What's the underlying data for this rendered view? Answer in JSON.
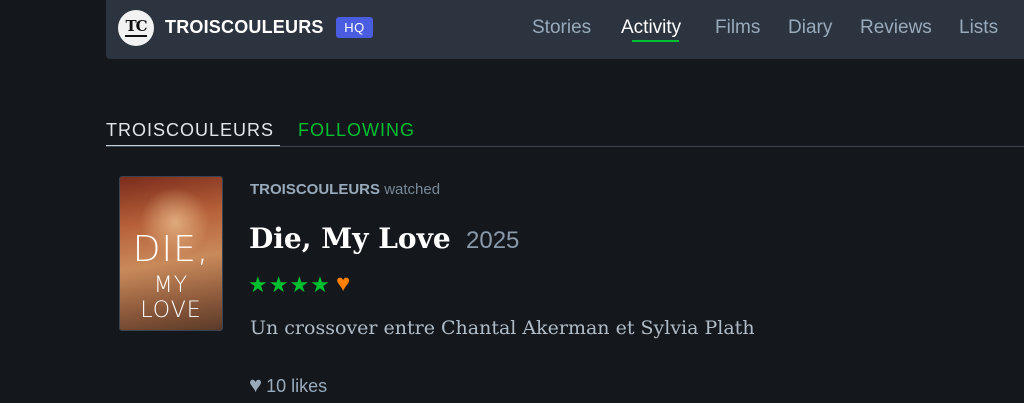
{
  "header": {
    "logo_icon": "tc-monogram-logo",
    "username": "TROISCOULEURS",
    "badge": "HQ",
    "nav": [
      {
        "label": "Stories",
        "active": false
      },
      {
        "label": "Activity",
        "active": true
      },
      {
        "label": "Films",
        "active": false
      },
      {
        "label": "Diary",
        "active": false
      },
      {
        "label": "Reviews",
        "active": false
      },
      {
        "label": "Lists",
        "active": false
      }
    ]
  },
  "tabs": {
    "user": "TROISCOULEURS",
    "following": "FOLLOWING"
  },
  "activity": {
    "user": "TROISCOULEURS",
    "action": "watched",
    "poster": {
      "line1": "DIE,",
      "line2": "MY LOVE"
    },
    "film_title": "Die, My Love",
    "film_year": "2025",
    "rating_stars": "★★★★",
    "rating_value": 4,
    "liked_icon": "heart-icon",
    "review": "Un crossover entre Chantal Akerman et Sylvia Plath",
    "likes": "10 likes"
  },
  "colors": {
    "background": "#14181c",
    "accent_green": "#00c030",
    "like_orange": "#ff8000",
    "badge_blue": "#4a5de0"
  }
}
